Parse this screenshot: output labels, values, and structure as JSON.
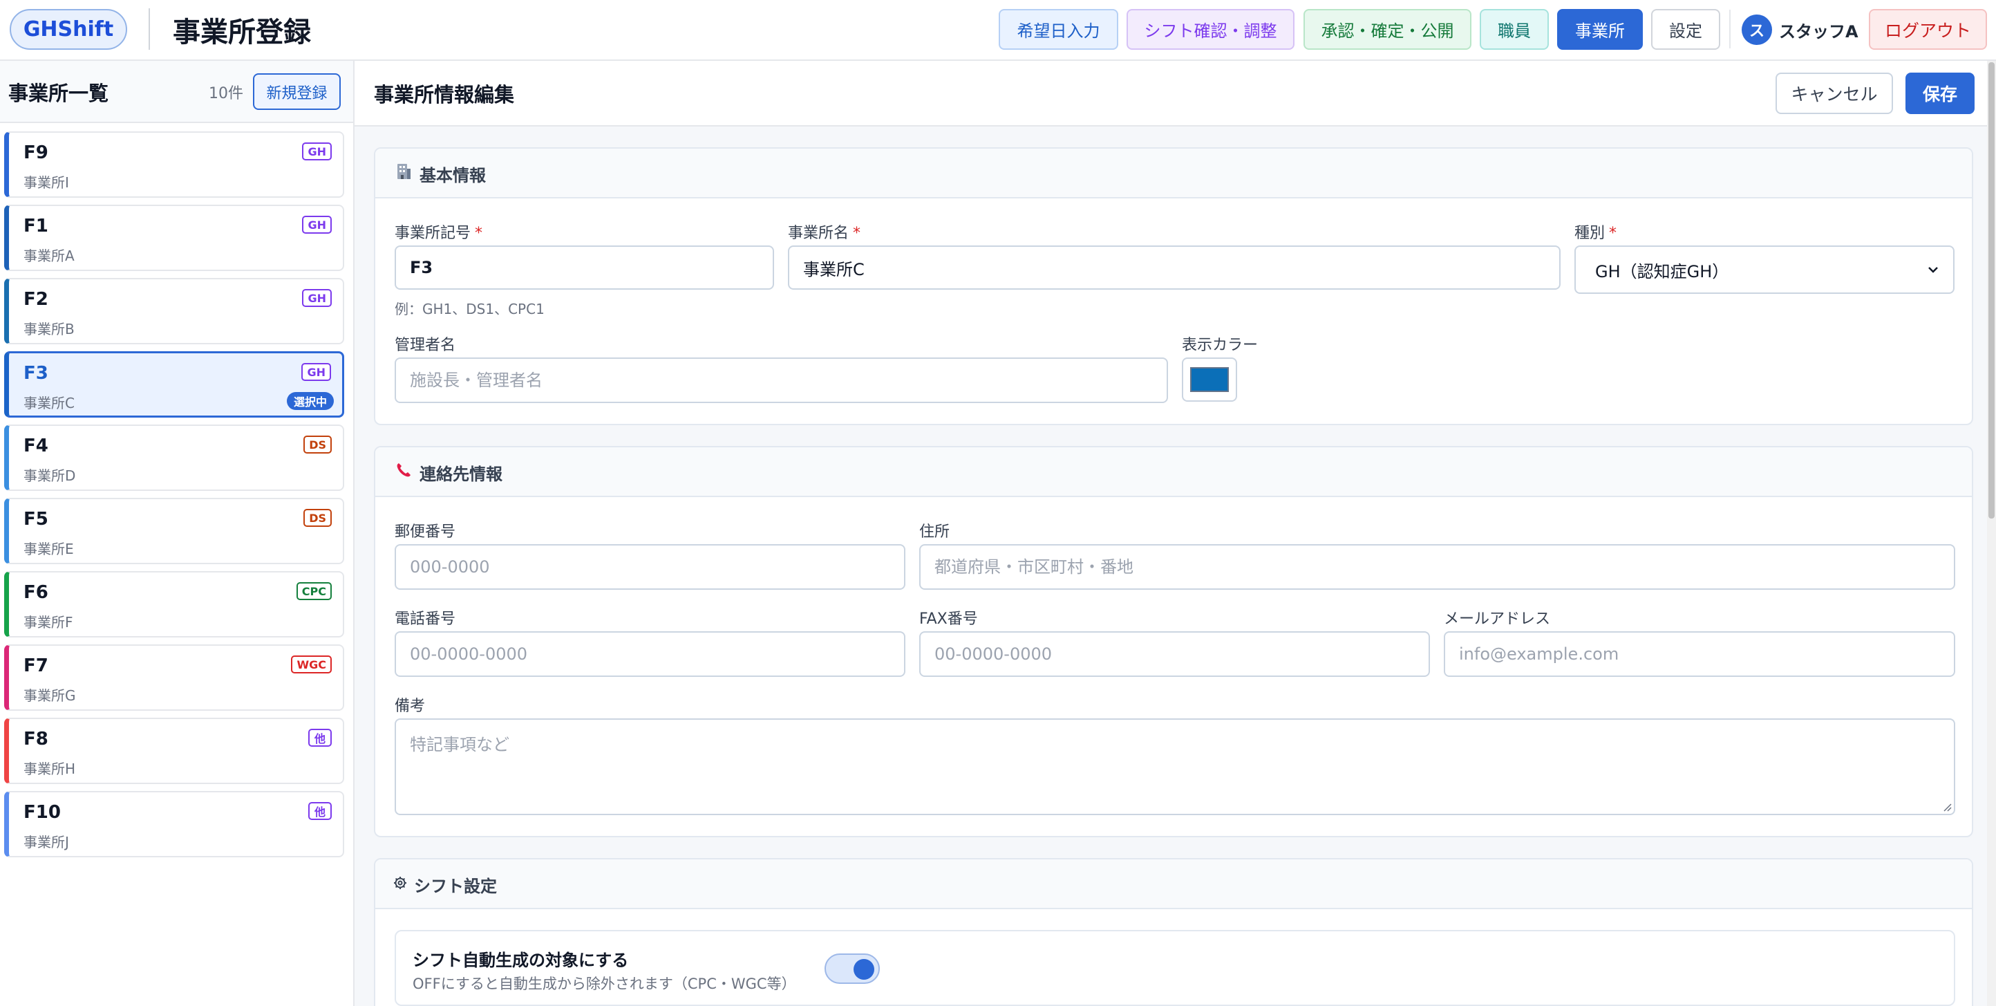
{
  "app": {
    "logo": "GHShift",
    "page_title": "事業所登録"
  },
  "nav": {
    "items": [
      {
        "label": "希望日入力"
      },
      {
        "label": "シフト確認・調整"
      },
      {
        "label": "承認・確定・公開"
      },
      {
        "label": "職員"
      },
      {
        "label": "事業所"
      },
      {
        "label": "設定"
      }
    ],
    "active": "事業所"
  },
  "user": {
    "avatar": "ス",
    "name": "スタッフA",
    "logout": "ログアウト"
  },
  "sidebar": {
    "title": "事業所一覧",
    "count": "10件",
    "new_label": "新規登録",
    "selected_badge": "選択中",
    "items": [
      {
        "code": "F9",
        "name": "事業所I",
        "type": "GH",
        "accent": "#2c68d6"
      },
      {
        "code": "F1",
        "name": "事業所A",
        "type": "GH",
        "accent": "#1e62b8"
      },
      {
        "code": "F2",
        "name": "事業所B",
        "type": "GH",
        "accent": "#1a6fb0"
      },
      {
        "code": "F3",
        "name": "事業所C",
        "type": "GH",
        "accent": "#1c64c8",
        "selected": true
      },
      {
        "code": "F4",
        "name": "事業所D",
        "type": "DS",
        "accent": "#3b8fe0"
      },
      {
        "code": "F5",
        "name": "事業所E",
        "type": "DS",
        "accent": "#3b8fe0"
      },
      {
        "code": "F6",
        "name": "事業所F",
        "type": "CPC",
        "accent": "#16a34a"
      },
      {
        "code": "F7",
        "name": "事業所G",
        "type": "WGC",
        "accent": "#db2777"
      },
      {
        "code": "F8",
        "name": "事業所H",
        "type": "他",
        "accent": "#ef4444"
      },
      {
        "code": "F10",
        "name": "事業所J",
        "type": "他",
        "accent": "#5b8def"
      }
    ]
  },
  "main": {
    "title": "事業所情報編集",
    "cancel_label": "キャンセル",
    "save_label": "保存",
    "basic": {
      "title": "基本情報",
      "code_label": "事業所記号",
      "code_value": "F3",
      "code_hint": "例：GH1、DS1、CPC1",
      "name_label": "事業所名",
      "name_value": "事業所C",
      "type_label": "種別",
      "type_value": "GH（認知症GH）",
      "manager_label": "管理者名",
      "manager_placeholder": "施設長・管理者名",
      "color_label": "表示カラー",
      "color_value": "#0b6fb8"
    },
    "contact": {
      "title": "連絡先情報",
      "postal_label": "郵便番号",
      "postal_placeholder": "000-0000",
      "address_label": "住所",
      "address_placeholder": "都道府県・市区町村・番地",
      "phone_label": "電話番号",
      "phone_placeholder": "00-0000-0000",
      "fax_label": "FAX番号",
      "fax_placeholder": "00-0000-0000",
      "email_label": "メールアドレス",
      "email_placeholder": "info@example.com",
      "notes_label": "備考",
      "notes_placeholder": "特記事項など"
    },
    "shift": {
      "title": "シフト設定",
      "toggle_title": "シフト自動生成の対象にする",
      "toggle_desc": "OFFにすると自動生成から除外されます（CPC・WGC等）",
      "toggle_on": true
    }
  },
  "colors": {
    "primary": "#2c68d6",
    "required": "#dc2626",
    "badge_gh": "#7c3aed",
    "badge_ds": "#c2410c",
    "badge_cpc": "#15803d",
    "badge_wgc": "#dc2626",
    "badge_other": "#7c3aed"
  }
}
